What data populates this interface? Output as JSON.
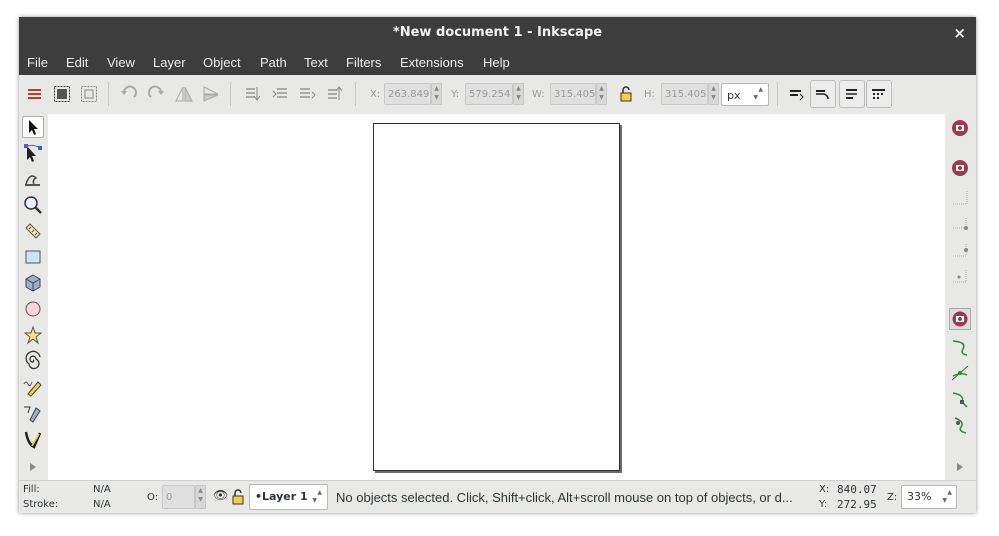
{
  "window": {
    "title": "*New document 1 - Inkscape",
    "close_glyph": "×"
  },
  "menu": [
    "File",
    "Edit",
    "View",
    "Layer",
    "Object",
    "Path",
    "Text",
    "Filters",
    "Extensions",
    "Help"
  ],
  "toolbar": {
    "x_label": "X:",
    "x_value": "263.849",
    "y_label": "Y:",
    "y_value": "579.254",
    "w_label": "W:",
    "w_value": "315.405",
    "h_label": "H:",
    "h_value": "315.405",
    "unit": "px",
    "icons": [
      "select-all-icon",
      "select-all-in-all-layers-icon",
      "deselect-icon",
      "rotate-ccw-icon",
      "rotate-cw-icon",
      "flip-horizontal-icon",
      "flip-vertical-icon",
      "lower-to-bottom-icon",
      "lower-icon",
      "raise-icon",
      "raise-to-top-icon",
      "lock-proportions-icon"
    ],
    "snap_icons": [
      "scale-stroke-icon",
      "scale-corners-icon",
      "transform-gradients-icon",
      "transform-patterns-icon"
    ]
  },
  "tools": [
    "selector-icon",
    "node-editor-icon",
    "tweak-icon",
    "zoom-icon",
    "measure-icon",
    "rectangle-icon",
    "3d-box-icon",
    "ellipse-icon",
    "star-icon",
    "spiral-icon",
    "pencil-icon",
    "pen-icon",
    "calligraphy-icon",
    "more-tools-icon"
  ],
  "snap_controls": [
    "snap-toggle-icon",
    "snap-bbox-icon",
    "snap-bbox-edges-icon",
    "snap-bbox-corners-icon",
    "snap-bbox-midpoints-icon",
    "snap-bbox-centers-icon",
    "snap-nodes-icon",
    "snap-paths-icon",
    "snap-intersections-icon",
    "snap-cusp-nodes-icon",
    "snap-smooth-nodes-icon",
    "more-snap-icon"
  ],
  "status": {
    "fill_label": "Fill:",
    "fill_value": "N/A",
    "stroke_label": "Stroke:",
    "stroke_value": "N/A",
    "opacity_label": "O:",
    "opacity_value": "0",
    "layer": "•Layer 1",
    "message": "No objects selected. Click, Shift+click, Alt+scroll mouse on top of objects, or d...",
    "x_label": "X:",
    "x_value": "840.07",
    "y_label": "Y:",
    "y_value": "272.95",
    "z_label": "Z:",
    "zoom": "33%"
  },
  "colors": {
    "titlebar": "#3d3d3d",
    "chrome": "#e8e8e7",
    "accent_red": "#c0392b",
    "snap_accent": "#9b3a4c",
    "path_green": "#2e8b2e"
  }
}
